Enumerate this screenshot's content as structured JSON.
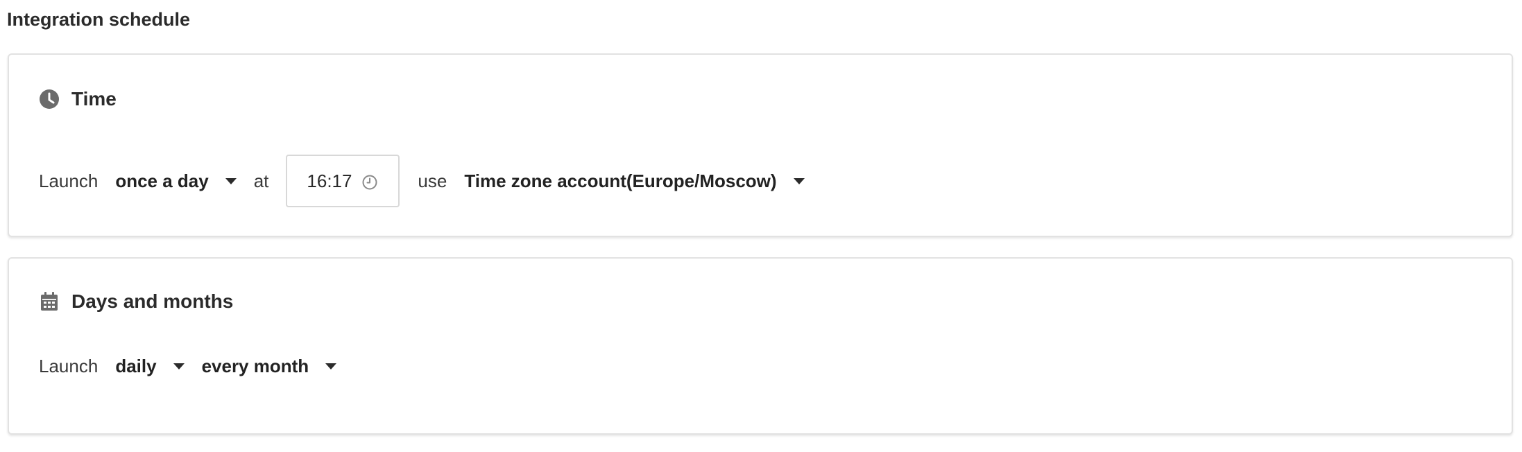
{
  "page": {
    "title": "Integration schedule"
  },
  "time_section": {
    "icon": "clock-icon",
    "title": "Time",
    "launch_label": "Launch",
    "frequency": "once a day",
    "at_label": "at",
    "time_value": "16:17",
    "time_icon": "clock-outline-icon",
    "use_label": "use",
    "timezone": "Time zone account(Europe/Moscow)"
  },
  "days_section": {
    "icon": "calendar-icon",
    "title": "Days and months",
    "launch_label": "Launch",
    "days_value": "daily",
    "months_value": "every month"
  },
  "colors": {
    "text": "#2b2b2b",
    "icon": "#6b6b6b",
    "border": "#e2e2e2"
  }
}
